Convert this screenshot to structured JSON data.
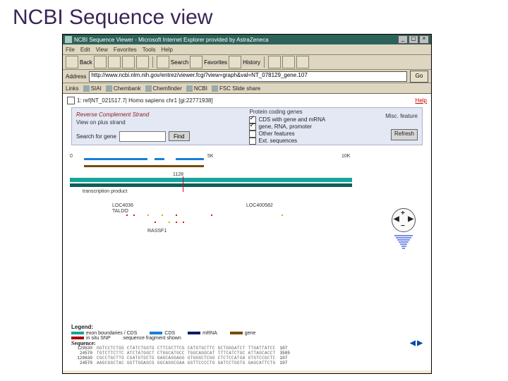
{
  "slide_title": "NCBI Sequence view",
  "window": {
    "title": "NCBI Sequence Viewer - Microsoft Internet Explorer provided by AstraZeneca"
  },
  "menu": [
    "File",
    "Edit",
    "View",
    "Favorites",
    "Tools",
    "Help"
  ],
  "toolbar": {
    "back": "Back",
    "search": "Search",
    "favorites": "Favorites",
    "history": "History"
  },
  "address": {
    "label": "Address",
    "url": "http://www.ncbi.nlm.nih.gov/entrez/viewer.fcgi?view=graph&val=NT_078129_gene.107",
    "go": "Go"
  },
  "links": {
    "label": "Links",
    "items": [
      "SIAI",
      "Chembank",
      "Chemfinder",
      "NCBI",
      "FSC Slide share"
    ]
  },
  "page": {
    "record": "1: ref|NT_021517.7| Homo sapiens chr1 [gi:22771938]",
    "help": "Help"
  },
  "panel": {
    "rev_header": "Reverse Complement Strand",
    "rev_sub": "View on plus strand",
    "search_label": "Search for gene",
    "find": "Find",
    "coding_header": "Protein coding genes",
    "opts": [
      "CDS with gene and mRNA",
      "gene, RNA, promoter",
      "Other features",
      "Ext. sequences"
    ],
    "misc_header": "Misc. feature",
    "refresh": "Refresh"
  },
  "tracks": {
    "start": "0",
    "mid": "5K",
    "end": "10K",
    "scale": "1128",
    "note": "transcription product",
    "genes": [
      "LOC4036",
      "TALDO",
      "LOC400582",
      "RASSF1"
    ]
  },
  "legend": {
    "title": "Legend:",
    "items": [
      "exon boundaries / CDS",
      "CDS",
      "mRNA",
      "gene",
      "in situ SNP",
      "sequence fragment shown"
    ]
  },
  "sequence": {
    "title": "Sequence:",
    "rows": [
      {
        "pos": "129630",
        "seq": "GGTCCTCTGG CTATCTGGTG CTTCGCTTCG CATGTGCTTC GCTGGGATCT TTGATTATCC",
        "end": "107"
      },
      {
        "pos": "24570",
        "seq": "TGTCTTCTTC ATCTATGGCT CTGGCATGCC TGGCAGGCAT TTTCATCTGC ATTAGCACCT",
        "end": "3585"
      },
      {
        "pos": "129630",
        "seq": "CGCCTGCTTG CGATGTGCTG GAGCAGGAGG GTGGGCTCGG CTCTCCATGA GTGTCCGCTC",
        "end": "107"
      },
      {
        "pos": "24570",
        "seq": "AAGCGGCTAC GGTTGGAGCG GGCAGGCGAA GGTTCCCCTG GATCCTGGTG GAGCATTCTG",
        "end": "107"
      }
    ]
  }
}
